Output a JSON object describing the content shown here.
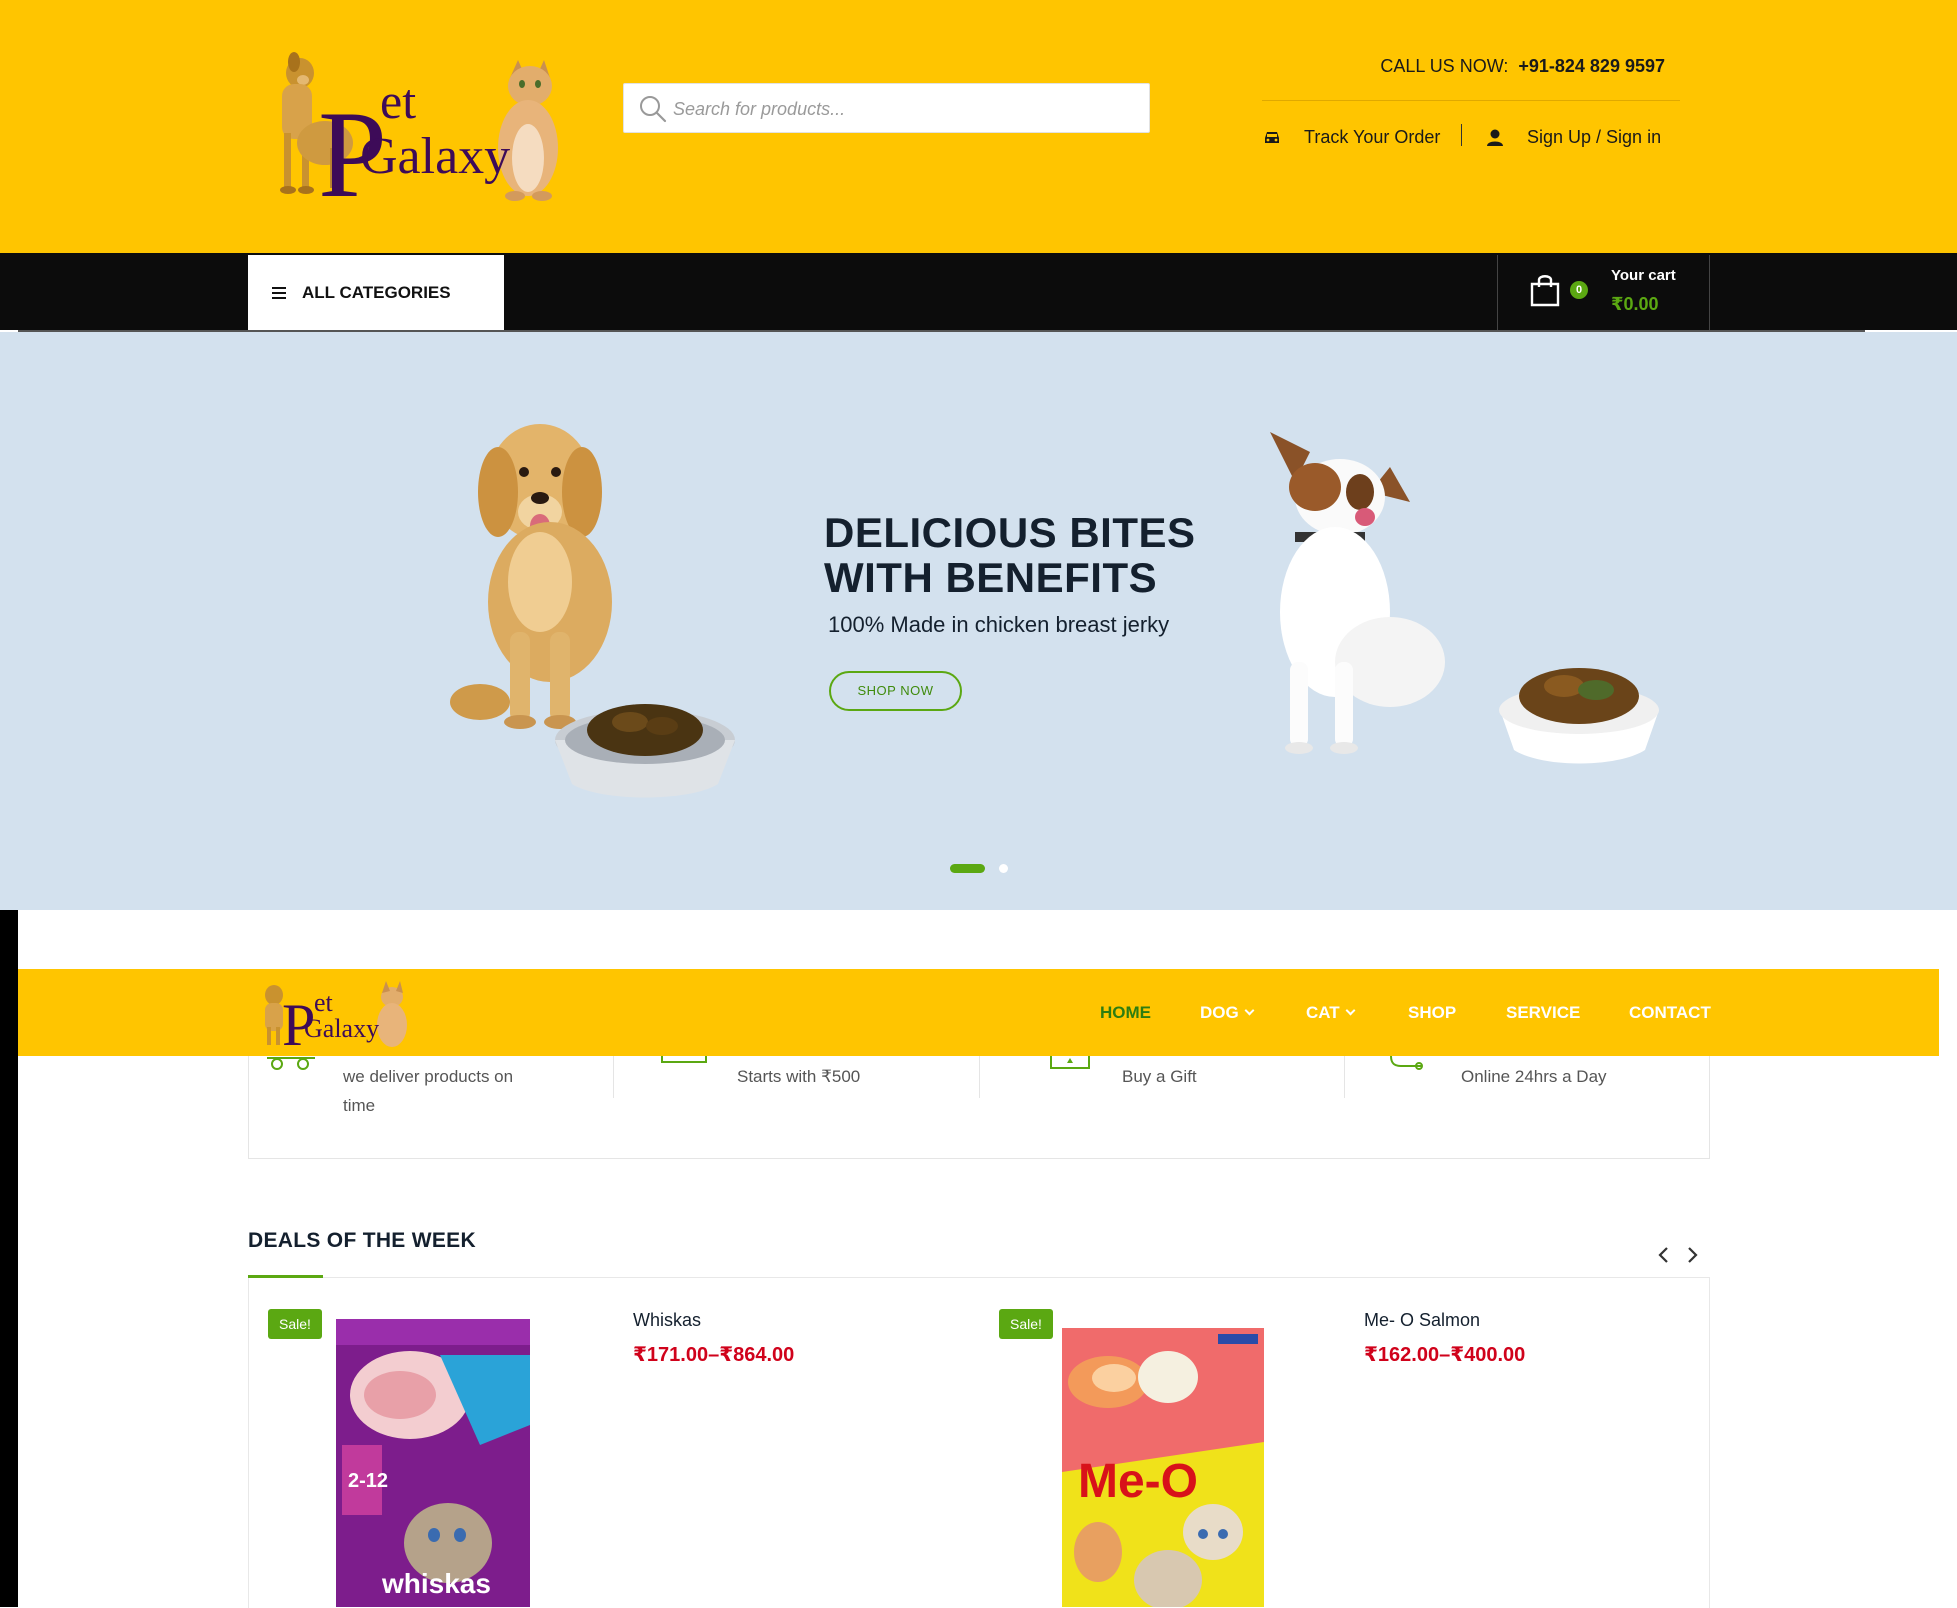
{
  "header": {
    "logo_text_1": "Pet",
    "logo_text_2": "Galaxy",
    "search_placeholder": "Search for products...",
    "call_label": "CALL US NOW:",
    "call_phone": "+91-824 829 9597",
    "track_order": "Track Your Order",
    "sign_in": "Sign Up / Sign in"
  },
  "category_bar": {
    "all_categories": "ALL CATEGORIES",
    "cart_count": "0",
    "cart_label": "Your cart",
    "cart_total": "₹0.00"
  },
  "hero": {
    "title_line1": "DELICIOUS BITES",
    "title_line2": "WITH BENEFITS",
    "subtitle": "100% Made in chicken breast jerky",
    "cta": "SHOP NOW",
    "slides_total": 2,
    "active_slide": 1
  },
  "nav": {
    "items": [
      {
        "label": "HOME",
        "active": true,
        "dropdown": false
      },
      {
        "label": "DOG",
        "active": false,
        "dropdown": true
      },
      {
        "label": "CAT",
        "active": false,
        "dropdown": true
      },
      {
        "label": "SHOP",
        "active": false,
        "dropdown": false
      },
      {
        "label": "SERVICE",
        "active": false,
        "dropdown": false
      },
      {
        "label": "CONTACT",
        "active": false,
        "dropdown": false
      }
    ]
  },
  "features": [
    {
      "text": "we deliver products on time",
      "icon": "truck-icon"
    },
    {
      "text": "Starts with ₹500",
      "icon": "wallet-icon"
    },
    {
      "text": "Buy a Gift",
      "icon": "gift-icon"
    },
    {
      "text": "Online 24hrs a Day",
      "icon": "support-icon"
    }
  ],
  "deals": {
    "title": "DEALS OF THE WEEK",
    "products": [
      {
        "badge": "Sale!",
        "name": "Whiskas",
        "price": "₹171.00–₹864.00"
      },
      {
        "badge": "Sale!",
        "name": "Me- O Salmon",
        "price": "₹162.00–₹400.00"
      }
    ]
  },
  "colors": {
    "brand_yellow": "#ffc500",
    "accent_green": "#5ba812",
    "price_red": "#d0021b",
    "hero_bg": "#d3e1ee",
    "nav_black": "#0c0c0c"
  }
}
